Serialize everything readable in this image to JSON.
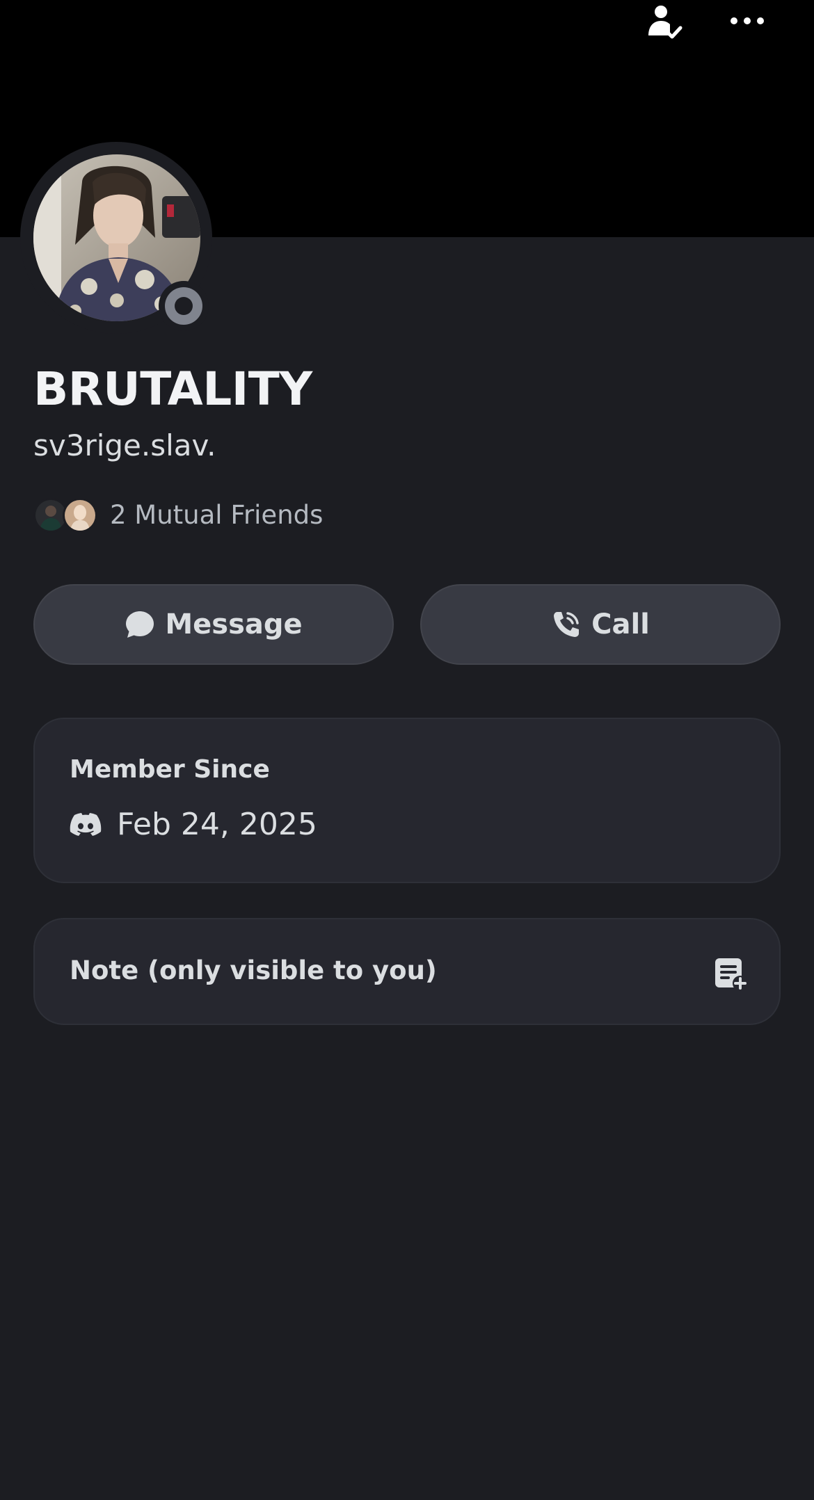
{
  "profile": {
    "display_name": "BRUTALITY",
    "username": "sv3rige.slav.",
    "status": "offline",
    "avatar_desc": "user avatar photo"
  },
  "header": {
    "friend_icon": "friend-check-icon",
    "more_icon": "more-horizontal-icon"
  },
  "mutual": {
    "text": "2 Mutual Friends"
  },
  "actions": {
    "message_label": "Message",
    "call_label": "Call"
  },
  "member_since": {
    "title": "Member Since",
    "date": "Feb 24, 2025"
  },
  "note": {
    "label": "Note (only visible to you)"
  },
  "colors": {
    "background": "#1c1d22",
    "banner": "#000000",
    "card": "#26272f",
    "button": "#383a43",
    "status_offline": "#80848e"
  }
}
